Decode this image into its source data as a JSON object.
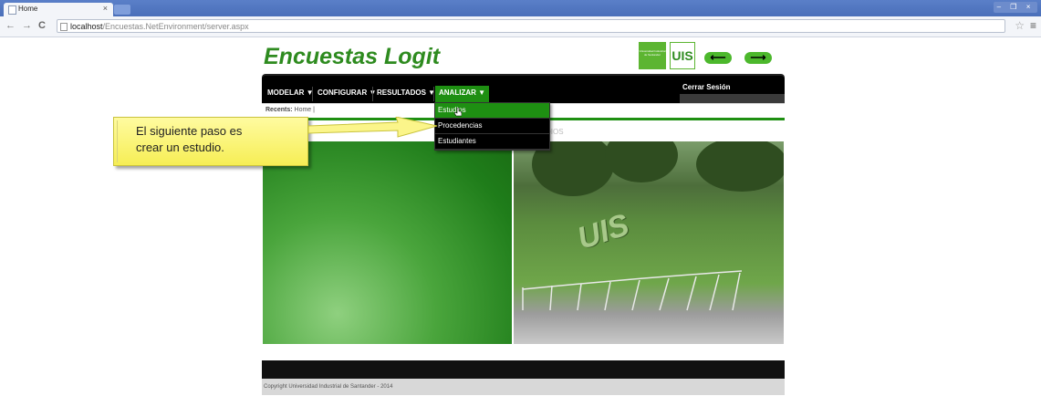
{
  "browser": {
    "tab_title": "Home",
    "tab_close": "×",
    "url_host": "localhost",
    "url_path": "/Encuestas.NetEnvironment/server.aspx",
    "back": "←",
    "forward": "→",
    "reload": "C",
    "window_controls": "– ❐ ×",
    "star": "☆",
    "menu": "≡"
  },
  "header": {
    "logo": "Encuestas Logit",
    "university_badge": "Universidad Industrial de Santander",
    "uis_logo": "UIS",
    "back_arrow": "⟵",
    "forward_arrow": "⟶"
  },
  "nav": {
    "items": [
      {
        "label": "MODELAR ▼"
      },
      {
        "label": "CONFIGURAR ▼"
      },
      {
        "label": "RESULTADOS ▼"
      },
      {
        "label": "ANALIZAR ▼"
      }
    ],
    "logout": "Cerrar Sesión"
  },
  "recents": {
    "label": "Recents:",
    "items": "Home |"
  },
  "dropdown": {
    "items": [
      "Estudios",
      "Procedencias",
      "Estudiantes"
    ]
  },
  "faded_text": "DIOS",
  "callout": {
    "line1": "El siguiente paso es",
    "line2": "crear un estudio."
  },
  "hero": {
    "hedge_text": "UIS"
  },
  "footer": {
    "copyright": "Copyright Universidad Industrial de Santander - 2014"
  },
  "colors": {
    "brand_green": "#1e8f12",
    "callout_yellow": "#f6ee55"
  }
}
